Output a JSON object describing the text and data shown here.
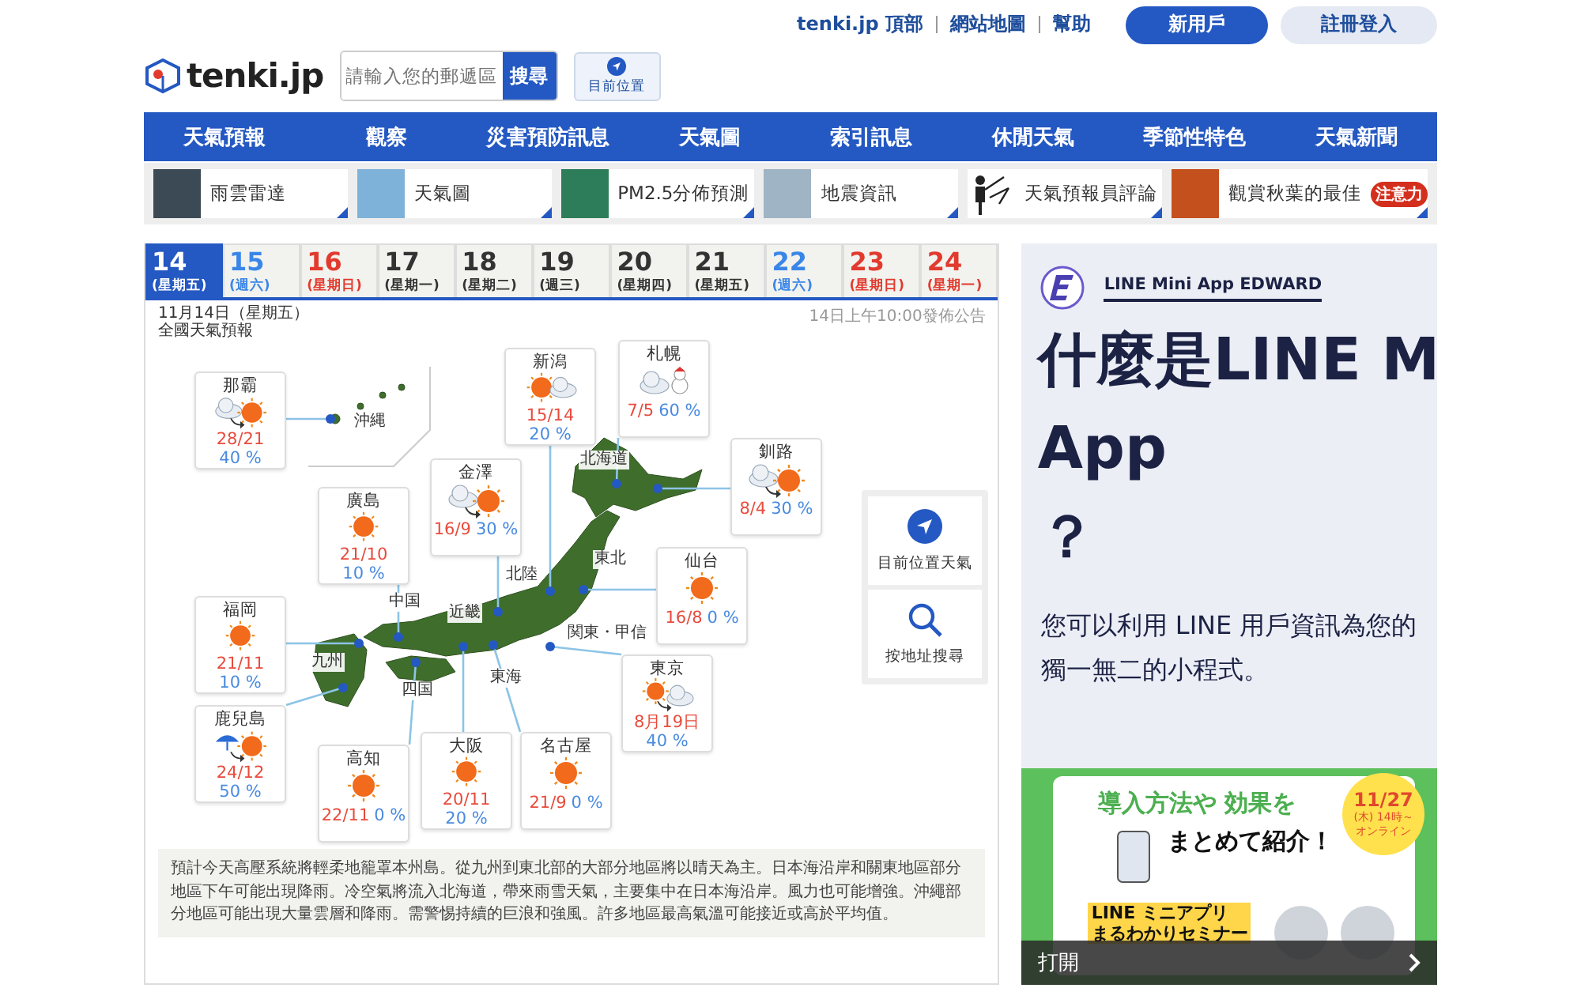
{
  "top_links": [
    "tenki.jp 頂部",
    "網站地圖",
    "幫助"
  ],
  "account_buttons": [
    {
      "label": "新用戶",
      "kind": "primary"
    },
    {
      "label": "註冊登入",
      "kind": "secondary"
    }
  ],
  "logo": {
    "text": "tenki.jp"
  },
  "search": {
    "placeholder": "請輸入您的郵遞區",
    "button": "搜尋",
    "location_button": "目前位置"
  },
  "nav": [
    "天氣預報",
    "觀察",
    "災害預防訊息",
    "天氣圖",
    "索引訊息",
    "休閒天氣",
    "季節性特色",
    "天氣新聞"
  ],
  "sub_nav": [
    {
      "label": "雨雲雷達",
      "kind": "radar"
    },
    {
      "label": "天氣圖",
      "kind": "chart"
    },
    {
      "label": "PM2.5分佈預測",
      "kind": "pm25"
    },
    {
      "label": "地震資訊",
      "kind": "quake"
    },
    {
      "label": "天氣預報員評論",
      "kind": "commentator"
    },
    {
      "label": "觀賞秋葉的最佳",
      "kind": "autumn",
      "badge": "注意力"
    }
  ],
  "date_tabs": [
    {
      "day": "14",
      "weekday": "(星期五)",
      "selected": true
    },
    {
      "day": "15",
      "weekday": "(週六)",
      "selected": false,
      "color": "#3a86e8"
    },
    {
      "day": "16",
      "weekday": "(星期日)",
      "selected": false,
      "color": "#e23a2e"
    },
    {
      "day": "17",
      "weekday": "(星期一)",
      "selected": false,
      "color": "#333333"
    },
    {
      "day": "18",
      "weekday": "(星期二)",
      "selected": false,
      "color": "#333333"
    },
    {
      "day": "19",
      "weekday": "(週三)",
      "selected": false,
      "color": "#333333"
    },
    {
      "day": "20",
      "weekday": "(星期四)",
      "selected": false,
      "color": "#333333"
    },
    {
      "day": "21",
      "weekday": "(星期五)",
      "selected": false,
      "color": "#333333"
    },
    {
      "day": "22",
      "weekday": "(週六)",
      "selected": false,
      "color": "#3a86e8"
    },
    {
      "day": "23",
      "weekday": "(星期日)",
      "selected": false,
      "color": "#e23a2e"
    },
    {
      "day": "24",
      "weekday": "(星期一)",
      "selected": false,
      "color": "#e23a2e"
    }
  ],
  "forecast": {
    "date": "11月14日（星期五）",
    "title": "全國天氣預報",
    "issued": "14日上午10:00發佈公告",
    "regions": [
      "沖縄",
      "北海道",
      "東北",
      "北陸",
      "中国",
      "近畿",
      "関東・甲信",
      "東海",
      "四国",
      "九州"
    ],
    "cities": [
      {
        "name": "那霸",
        "kind": "cloud_then_sun",
        "temps": "28/21",
        "pop": "40 %"
      },
      {
        "name": "新潟",
        "kind": "sun_cloud",
        "temps": "15/14",
        "pop": "20 %"
      },
      {
        "name": "札幌",
        "kind": "cloud_snow",
        "temps": "7/5",
        "pop": "60 %"
      },
      {
        "name": "金澤",
        "kind": "cloud_then_sun",
        "temps": "16/9",
        "pop": "30 %"
      },
      {
        "name": "釧路",
        "kind": "cloud_then_sun",
        "temps": "8/4",
        "pop": "30 %"
      },
      {
        "name": "廣島",
        "kind": "sun",
        "temps": "21/10",
        "pop": "10 %"
      },
      {
        "name": "仙台",
        "kind": "sun",
        "temps": "16/8",
        "pop": "0 %"
      },
      {
        "name": "福岡",
        "kind": "sun",
        "temps": "21/11",
        "pop": "10 %"
      },
      {
        "name": "東京",
        "kind": "sun_then_cloud",
        "temps": "8月19日",
        "pop": "40 %"
      },
      {
        "name": "鹿兒島",
        "kind": "rain_then_sun",
        "temps": "24/12",
        "pop": "50 %"
      },
      {
        "name": "高知",
        "kind": "sun",
        "temps": "22/11",
        "pop": "0 %"
      },
      {
        "name": "大阪",
        "kind": "sun",
        "temps": "20/11",
        "pop": "20 %"
      },
      {
        "name": "名古屋",
        "kind": "sun",
        "temps": "21/9",
        "pop": "0 %"
      }
    ],
    "side_buttons": [
      {
        "label": "目前位置天氣",
        "kind": "locate"
      },
      {
        "label": "按地址搜尋",
        "kind": "search"
      }
    ],
    "summary": "預計今天高壓系統將輕柔地籠罩本州島。從九州到東北部的大部分地區將以晴天為主。日本海沿岸和關東地區部分地區下午可能出現降雨。冷空氣將流入北海道，帶來雨雪天氣，主要集中在日本海沿岸。風力也可能增強。沖繩部分地區可能出現大量雲層和降雨。需警惕持續的巨浪和強風。許多地區最高氣溫可能接近或高於平均值。"
  },
  "ad": {
    "brand": "LINE Mini App EDWARD",
    "headline_lines": [
      "什麼是LINE M",
      "App",
      "？"
    ],
    "body_lines": [
      "您可以利用 LINE 用戶資訊為您的",
      "獨一無二的小程式。"
    ],
    "banner": {
      "title_line_1": "導入方法や 効果を",
      "title_line_2": "まとめて紹介！",
      "date": "11/27",
      "time": "(木) 14時～",
      "mode": "オンライン",
      "seminar_lines": [
        "LINE ミニアプリ",
        "まるわかりセミナー"
      ]
    },
    "open_button": "打開"
  }
}
